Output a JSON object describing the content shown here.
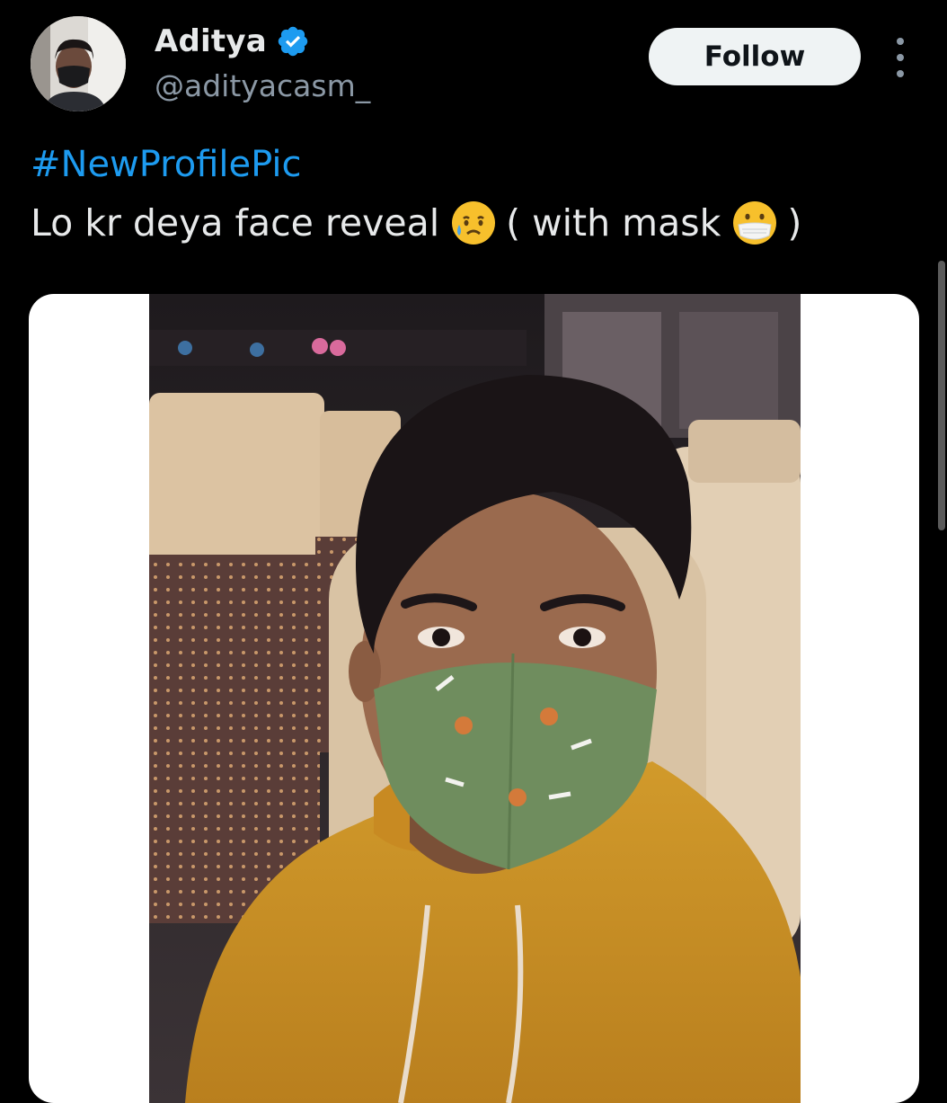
{
  "author": {
    "display_name": "Aditya",
    "handle": "@adityacasm_",
    "verified": true,
    "verified_icon": "verified-badge-icon",
    "avatar_icon": "profile-avatar"
  },
  "actions": {
    "follow_label": "Follow",
    "more_icon": "more-vertical-icon"
  },
  "tweet": {
    "hashtag": "#NewProfilePic",
    "text_before_emoji": "Lo kr deya face reveal",
    "emoji_1": "sad-but-relieved-face-icon",
    "text_middle": "( with mask",
    "emoji_2": "face-with-medical-mask-icon",
    "text_after_emoji": ")"
  },
  "media": {
    "type": "photo",
    "subject": "selfie"
  },
  "colors": {
    "background": "#000000",
    "text_primary": "#e7e9ea",
    "text_secondary": "#8b98a5",
    "link": "#1d9bf0",
    "verified": "#1d9bf0",
    "follow_bg": "#eff3f4"
  }
}
